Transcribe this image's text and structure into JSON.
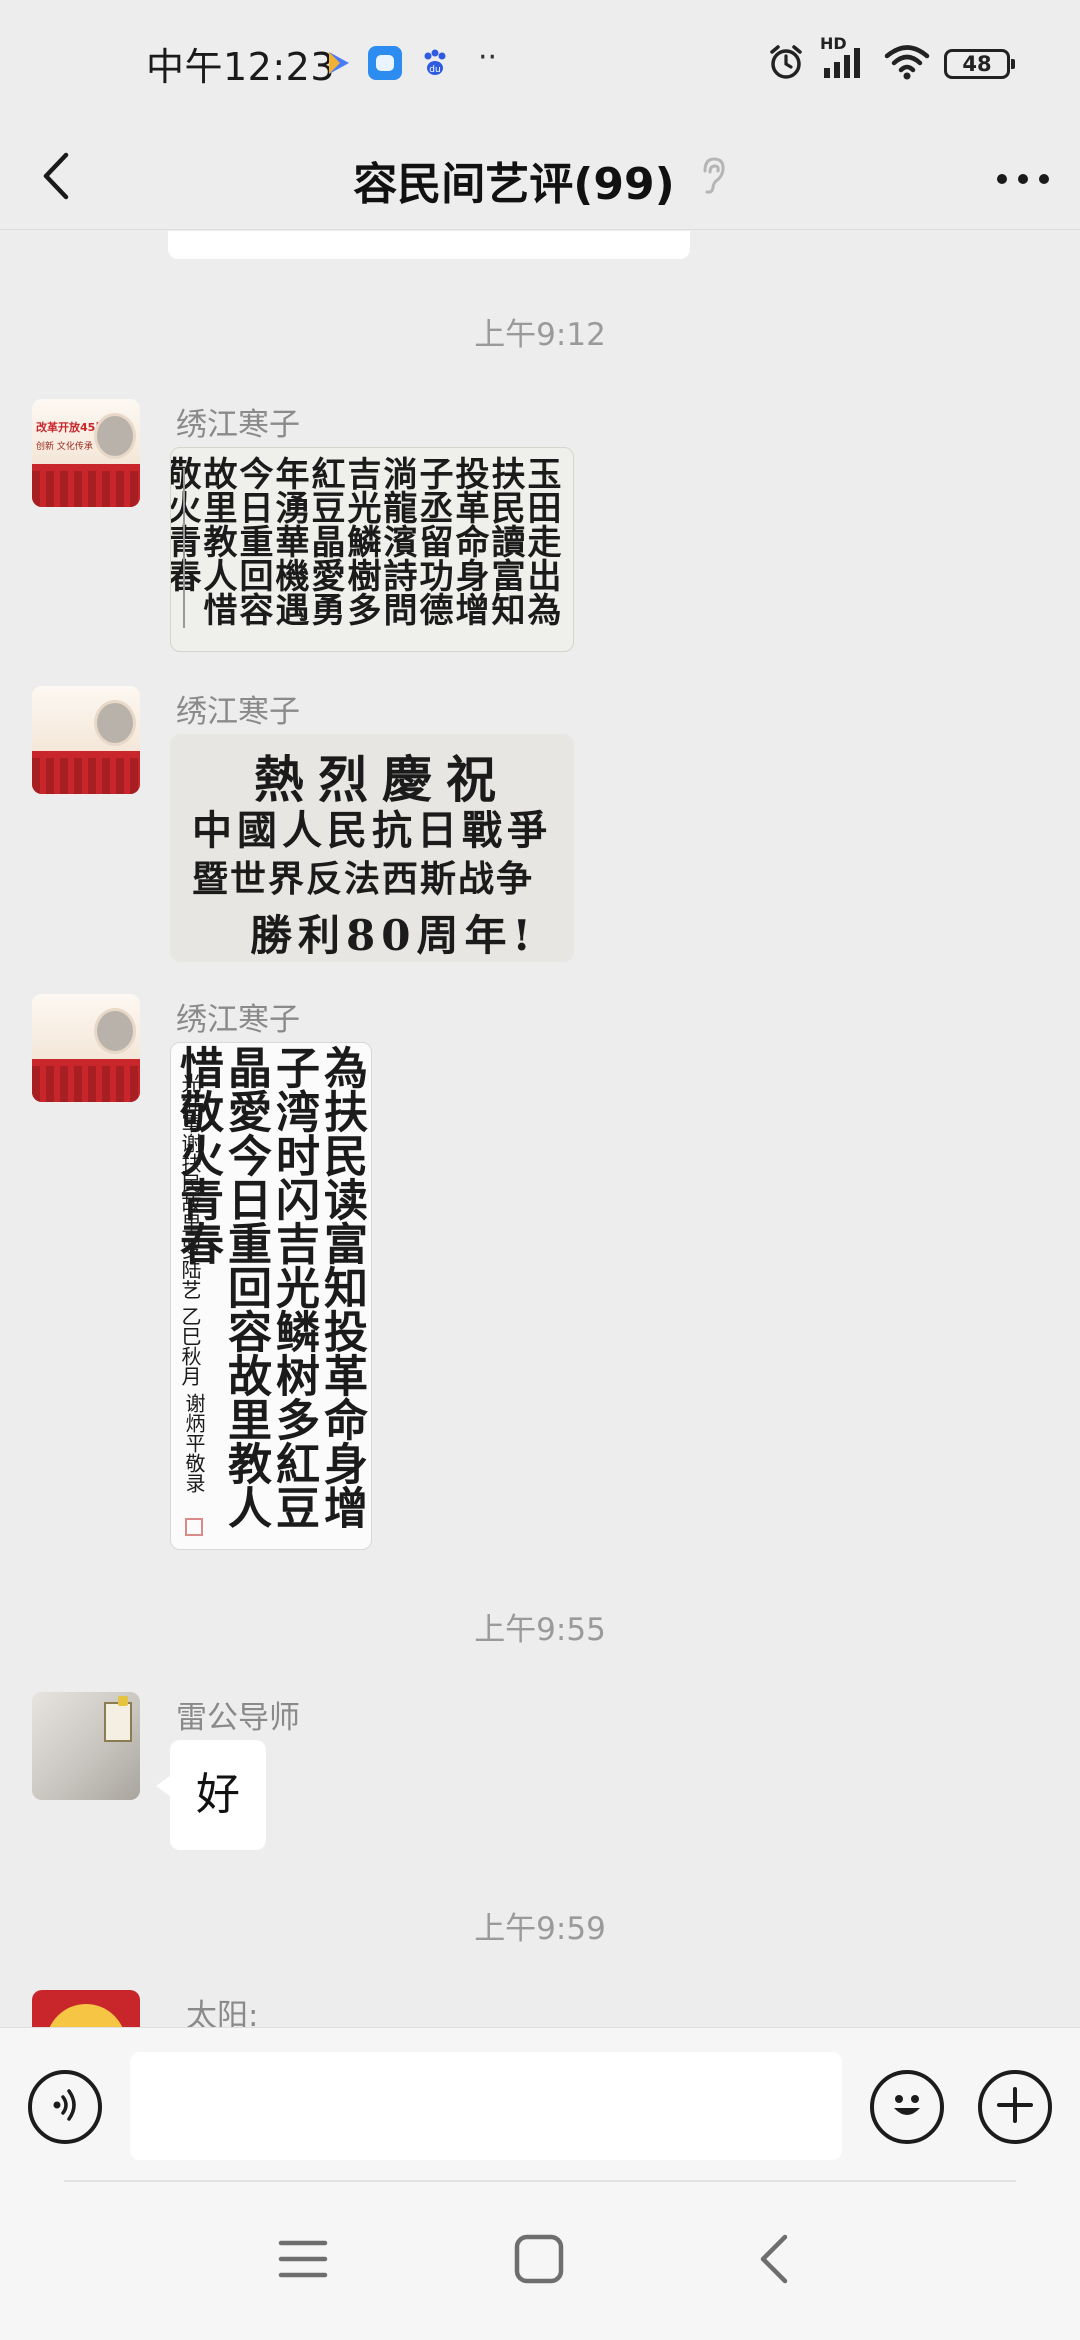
{
  "status_bar": {
    "time": "中午12:23",
    "extra_indicator": "··",
    "network_label": "HD",
    "battery": "48"
  },
  "header": {
    "title": "容民间艺评(99)",
    "back_icon": "chevron-left-icon",
    "muted_icon": "ear-icon",
    "more_icon": "more-dots-icon"
  },
  "chat": {
    "messages": [
      {
        "type": "timestamp",
        "text": "上午9:12"
      },
      {
        "type": "image",
        "sender": "绣江寒子",
        "avatar_text": "改革开放45周年",
        "avatar_subtext": "创新 文化传承"
      },
      {
        "type": "image",
        "sender": "绣江寒子",
        "caption_lines": [
          "熱烈慶祝",
          "中國人民抗日戰爭",
          "暨世界反法西斯战争",
          "勝利80周年!"
        ]
      },
      {
        "type": "image",
        "sender": "绣江寒子"
      },
      {
        "type": "timestamp",
        "text": "上午9:55"
      },
      {
        "type": "text",
        "sender": "雷公导师",
        "text": "好"
      },
      {
        "type": "timestamp",
        "text": "上午9:59"
      },
      {
        "type": "partial",
        "sender": "太阳:"
      }
    ]
  },
  "input_bar": {
    "voice_icon": "voice-icon",
    "input_value": "",
    "emoji_icon": "emoji-icon",
    "plus_icon": "plus-icon"
  },
  "system_nav": {
    "menu_icon": "menu-icon",
    "home_icon": "home-square-icon",
    "back_icon": "back-triangle-icon"
  },
  "colors": {
    "background": "#ededed",
    "bubble": "#ffffff",
    "timestamp_text": "#9a9a9a",
    "avatar_red": "#c8262b"
  }
}
